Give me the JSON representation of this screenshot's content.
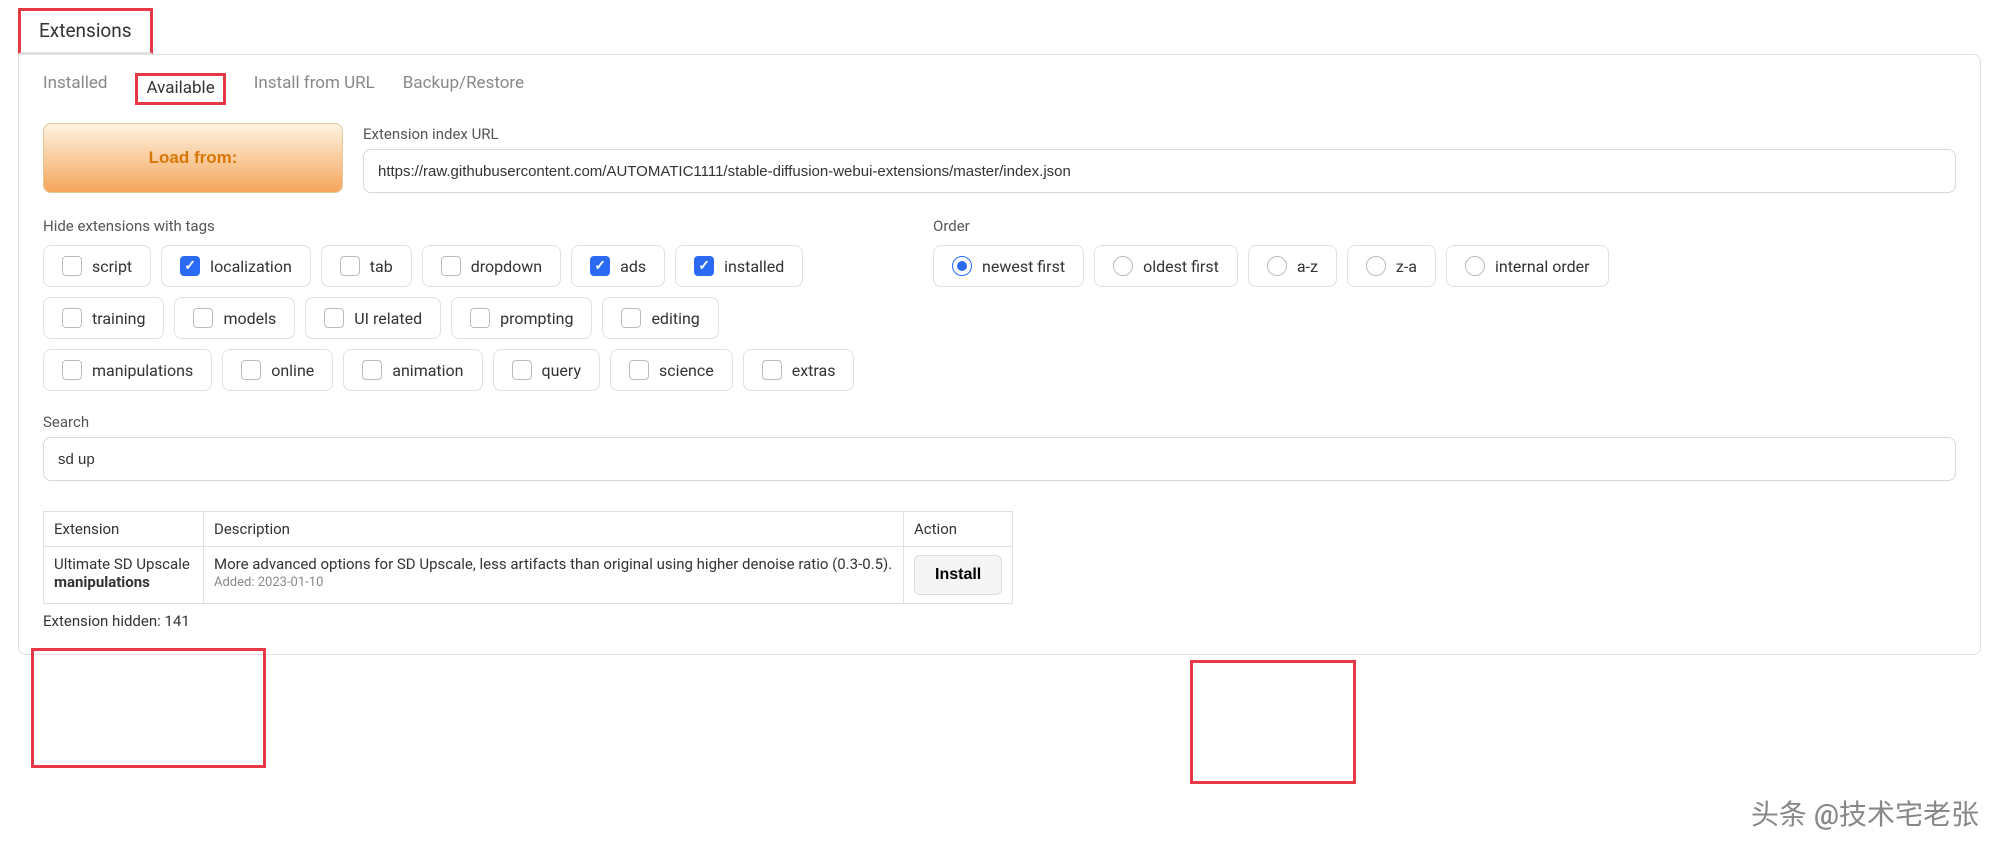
{
  "main_tab": "Extensions",
  "subtabs": {
    "installed": "Installed",
    "available": "Available",
    "install_from_url": "Install from URL",
    "backup_restore": "Backup/Restore"
  },
  "load_button": "Load from:",
  "index_url_label": "Extension index URL",
  "index_url_value": "https://raw.githubusercontent.com/AUTOMATIC1111/stable-diffusion-webui-extensions/master/index.json",
  "hide_tags_label": "Hide extensions with tags",
  "tags": [
    {
      "label": "script",
      "checked": false
    },
    {
      "label": "localization",
      "checked": true
    },
    {
      "label": "tab",
      "checked": false
    },
    {
      "label": "dropdown",
      "checked": false
    },
    {
      "label": "ads",
      "checked": true
    },
    {
      "label": "installed",
      "checked": true
    },
    {
      "label": "training",
      "checked": false
    },
    {
      "label": "models",
      "checked": false
    },
    {
      "label": "UI related",
      "checked": false
    },
    {
      "label": "prompting",
      "checked": false
    },
    {
      "label": "editing",
      "checked": false
    },
    {
      "label": "manipulations",
      "checked": false
    },
    {
      "label": "online",
      "checked": false
    },
    {
      "label": "animation",
      "checked": false
    },
    {
      "label": "query",
      "checked": false
    },
    {
      "label": "science",
      "checked": false
    },
    {
      "label": "extras",
      "checked": false
    }
  ],
  "order_label": "Order",
  "orders": [
    {
      "label": "newest first",
      "checked": true
    },
    {
      "label": "oldest first",
      "checked": false
    },
    {
      "label": "a-z",
      "checked": false
    },
    {
      "label": "z-a",
      "checked": false
    },
    {
      "label": "internal order",
      "checked": false
    }
  ],
  "search_label": "Search",
  "search_value": "sd up",
  "table": {
    "headers": {
      "extension": "Extension",
      "description": "Description",
      "action": "Action"
    },
    "rows": [
      {
        "name": "Ultimate SD Upscale",
        "tag": "manipulations",
        "description": "More advanced options for SD Upscale, less artifacts than original using higher denoise ratio (0.3-0.5).",
        "added": "Added: 2023-01-10",
        "action": "Install"
      }
    ]
  },
  "hidden_text": "Extension hidden: 141",
  "watermark": "头条 @技术宅老张"
}
